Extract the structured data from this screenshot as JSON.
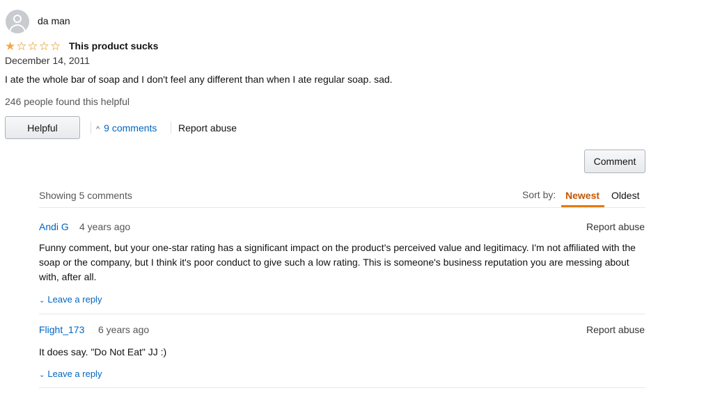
{
  "review": {
    "username": "da man",
    "rating": 1,
    "rating_max": 5,
    "title": "This product sucks",
    "date": "December 14, 2011",
    "body": "I ate the whole bar of soap and I don't feel any different than when I ate regular soap. sad.",
    "helpful_count_text": "246 people found this helpful",
    "helpful_button": "Helpful",
    "comments_link": "9 comments",
    "report_abuse": "Report abuse"
  },
  "comments_section": {
    "comment_button": "Comment",
    "showing_text": "Showing 5 comments",
    "sort_label": "Sort by:",
    "sort_options": [
      "Newest",
      "Oldest"
    ],
    "sort_selected": "Newest",
    "comments": [
      {
        "author": "Andi G",
        "ago": "4 years ago",
        "report": "Report abuse",
        "text": "Funny comment, but your one-star rating has a significant impact on the product's perceived value and legitimacy. I'm not affiliated with the soap or the company, but I think it's poor conduct to give such a low rating. This is someone's business reputation you are messing about with, after all.",
        "reply": "Leave a reply"
      },
      {
        "author": "Flight_173",
        "ago": "6 years ago",
        "report": "Report abuse",
        "text": "It does say. \"Do Not Eat\" JJ :)",
        "reply": "Leave a reply"
      }
    ]
  },
  "colors": {
    "link": "#0066c0",
    "star": "#f3a847",
    "sort_selected": "#c45500",
    "sort_underline": "#e47911"
  },
  "icons": {
    "avatar": "user-silhouette-icon",
    "star": "star-icon",
    "expand": "chevron-up-icon",
    "reply": "chevron-down-icon"
  }
}
